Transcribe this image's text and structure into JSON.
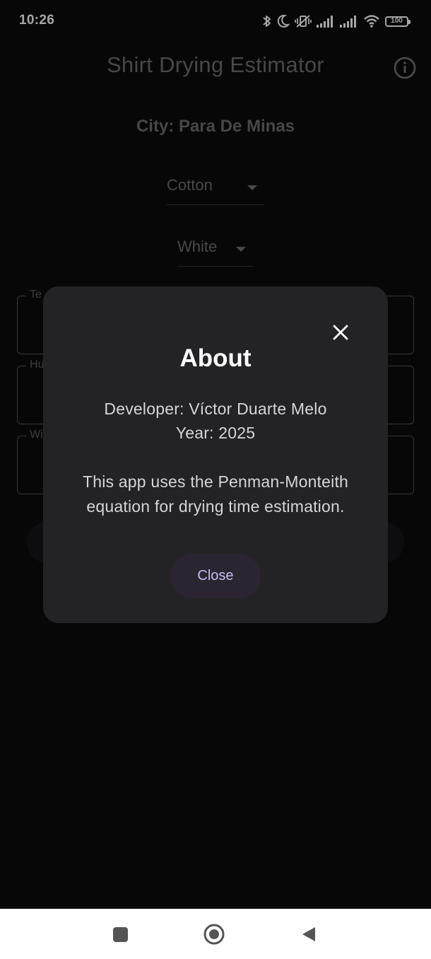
{
  "status_bar": {
    "time": "10:26",
    "battery": "100",
    "icons": [
      "bluetooth-icon",
      "do-not-disturb-moon-icon",
      "silent-vibrate-icon",
      "signal-icon",
      "signal-icon",
      "wifi-icon",
      "battery-icon"
    ]
  },
  "app": {
    "title": "Shirt Drying Estimator",
    "info_icon": "info-icon",
    "city": "City: Para De Minas",
    "fabric_dropdown": {
      "value": "Cotton"
    },
    "color_dropdown": {
      "value": "White"
    },
    "fields": [
      {
        "label": "Te"
      },
      {
        "label": "Hu"
      },
      {
        "label": "Wi"
      }
    ]
  },
  "dialog": {
    "title": "About",
    "developer": "Developer: Víctor Duarte Melo",
    "year": "Year: 2025",
    "description_line1": "This app uses the Penman-Monteith",
    "description_line2": "equation for drying time estimation.",
    "close_label": "Close",
    "close_icon": "close-icon"
  },
  "nav_bar": {
    "buttons": [
      "recents-icon",
      "home-icon",
      "back-icon"
    ]
  },
  "colors": {
    "background": "#0b0b0d",
    "dialog_bg": "#232325",
    "accent": "#cdb9f3"
  }
}
